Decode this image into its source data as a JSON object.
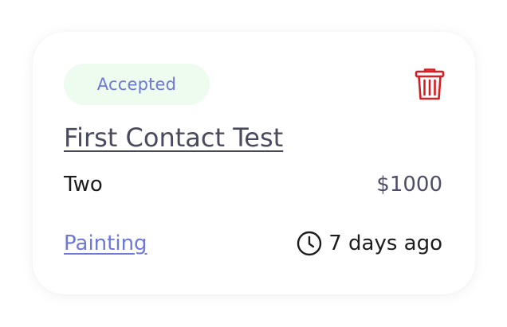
{
  "card": {
    "status": "Accepted",
    "title": "First Contact Test",
    "subtitle": "Two",
    "price": "$1000",
    "category": "Painting",
    "time_ago": "7 days ago"
  },
  "icons": {
    "delete": "trash-icon",
    "time": "clock-icon"
  },
  "colors": {
    "status_bg": "#eefcf0",
    "status_text": "#6d78d8",
    "delete": "#d51f24",
    "link": "#6d78d8",
    "title": "#4a4a5e"
  }
}
